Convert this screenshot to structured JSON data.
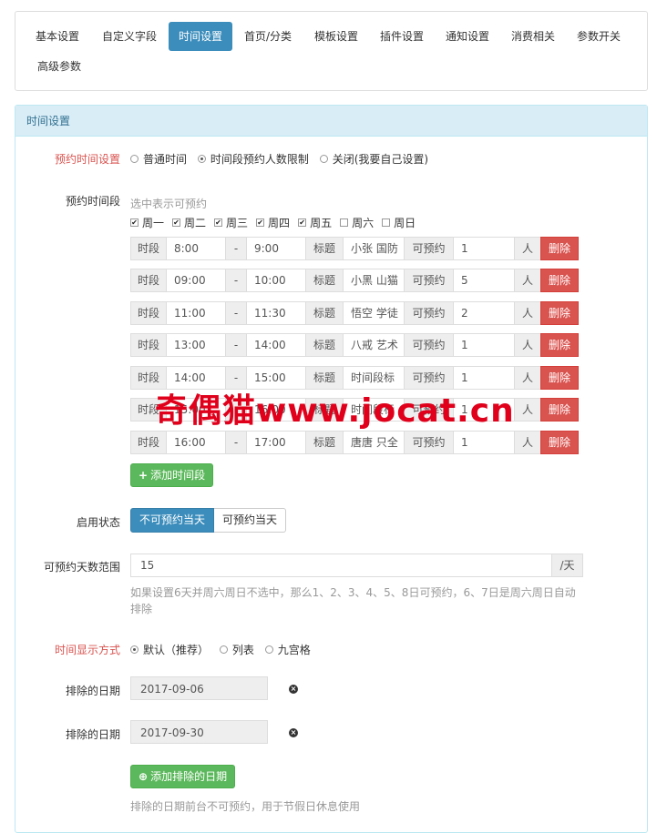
{
  "tabs": [
    "基本设置",
    "自定义字段",
    "时间设置",
    "首页/分类",
    "模板设置",
    "插件设置",
    "通知设置",
    "消费相关",
    "参数开关",
    "高级参数"
  ],
  "panel": {
    "title": "时间设置"
  },
  "reservation_setting": {
    "label": "预约时间设置",
    "options": [
      "普通时间",
      "时间段预约人数限制",
      "关闭(我要自己设置)"
    ],
    "selected": 1
  },
  "slots": {
    "label": "预约时间段",
    "hint": "选中表示可预约",
    "days": [
      {
        "name": "周一",
        "checked": true
      },
      {
        "name": "周二",
        "checked": true
      },
      {
        "name": "周三",
        "checked": true
      },
      {
        "name": "周四",
        "checked": true
      },
      {
        "name": "周五",
        "checked": true
      },
      {
        "name": "周六",
        "checked": false
      },
      {
        "name": "周日",
        "checked": false
      }
    ],
    "addon_period": "时段",
    "addon_dash": "-",
    "addon_title": "标题",
    "addon_available": "可预约",
    "addon_person": "人",
    "delete_label": "删除",
    "rows": [
      {
        "start": "8:00",
        "end": "9:00",
        "title": "小张 国防",
        "count": "1"
      },
      {
        "start": "09:00",
        "end": "10:00",
        "title": "小黑 山猫",
        "count": "5"
      },
      {
        "start": "11:00",
        "end": "11:30",
        "title": "悟空 学徒",
        "count": "2"
      },
      {
        "start": "13:00",
        "end": "14:00",
        "title": "八戒 艺术",
        "count": "1"
      },
      {
        "start": "14:00",
        "end": "15:00",
        "title": "时间段标",
        "count": "1"
      },
      {
        "start": "15:00",
        "end": "16:00",
        "title": "时间段标",
        "count": "1"
      },
      {
        "start": "16:00",
        "end": "17:00",
        "title": "唐唐 只全",
        "count": "1"
      }
    ],
    "add_label": "添加时间段"
  },
  "enable_status": {
    "label": "启用状态",
    "options": [
      "不可预约当天",
      "可预约当天"
    ],
    "selected": 0
  },
  "days_range": {
    "label": "可预约天数范围",
    "value": "15",
    "unit": "/天",
    "hint": "如果设置6天并周六周日不选中，那么1、2、3、4、5、8日可预约，6、7日是周六周日自动排除"
  },
  "display_mode": {
    "label": "时间显示方式",
    "options": [
      "默认（推荐）",
      "列表",
      "九宫格"
    ],
    "selected": 0
  },
  "excluded": {
    "label": "排除的日期",
    "dates": [
      "2017-09-06",
      "2017-09-30"
    ],
    "add_label": "添加排除的日期",
    "hint": "排除的日期前台不可预约，用于节假日休息使用"
  },
  "watermark": "奇偶猫www.jocat.cn",
  "colors": {
    "primary": "#3c8dbc",
    "danger": "#d9534f",
    "success": "#5cb85c",
    "label_red": "#d9534f"
  }
}
